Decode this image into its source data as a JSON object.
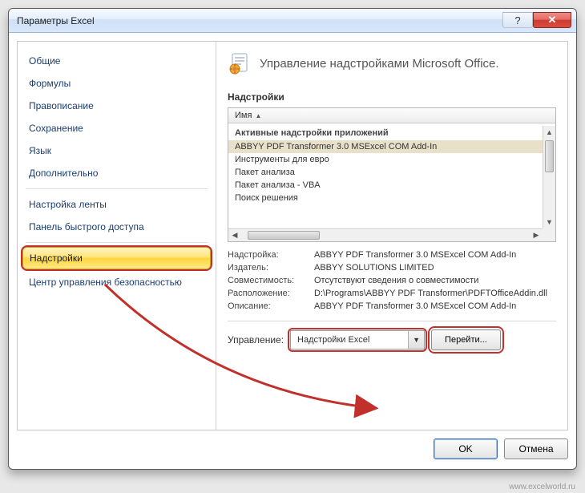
{
  "window": {
    "title": "Параметры Excel"
  },
  "sidebar": {
    "items": [
      {
        "label": "Общие"
      },
      {
        "label": "Формулы"
      },
      {
        "label": "Правописание"
      },
      {
        "label": "Сохранение"
      },
      {
        "label": "Язык"
      },
      {
        "label": "Дополнительно"
      },
      {
        "label": "Настройка ленты"
      },
      {
        "label": "Панель быстрого доступа"
      },
      {
        "label": "Надстройки",
        "selected": true
      },
      {
        "label": "Центр управления безопасностью"
      }
    ]
  },
  "main": {
    "header": "Управление надстройками Microsoft Office.",
    "section_title": "Надстройки",
    "list_header": "Имя",
    "group_label": "Активные надстройки приложений",
    "rows": [
      "ABBYY PDF Transformer 3.0 MSExcel COM Add-In",
      "Инструменты для евро",
      "Пакет анализа",
      "Пакет анализа - VBA",
      "Поиск решения"
    ],
    "details": {
      "labels": {
        "addin": "Надстройка:",
        "publisher": "Издатель:",
        "compat": "Совместимость:",
        "location": "Расположение:",
        "desc": "Описание:"
      },
      "values": {
        "addin": "ABBYY PDF Transformer 3.0 MSExcel COM Add-In",
        "publisher": "ABBYY SOLUTIONS LIMITED",
        "compat": "Отсутствуют сведения о совместимости",
        "location": "D:\\Programs\\ABBYY PDF Transformer\\PDFTOfficeAddin.dll",
        "desc": "ABBYY PDF Transformer 3.0 MSExcel COM Add-In"
      }
    },
    "manage": {
      "label": "Управление:",
      "dropdown": "Надстройки Excel",
      "button": "Перейти..."
    }
  },
  "footer": {
    "ok": "OK",
    "cancel": "Отмена"
  },
  "watermark": "www.excelworld.ru"
}
